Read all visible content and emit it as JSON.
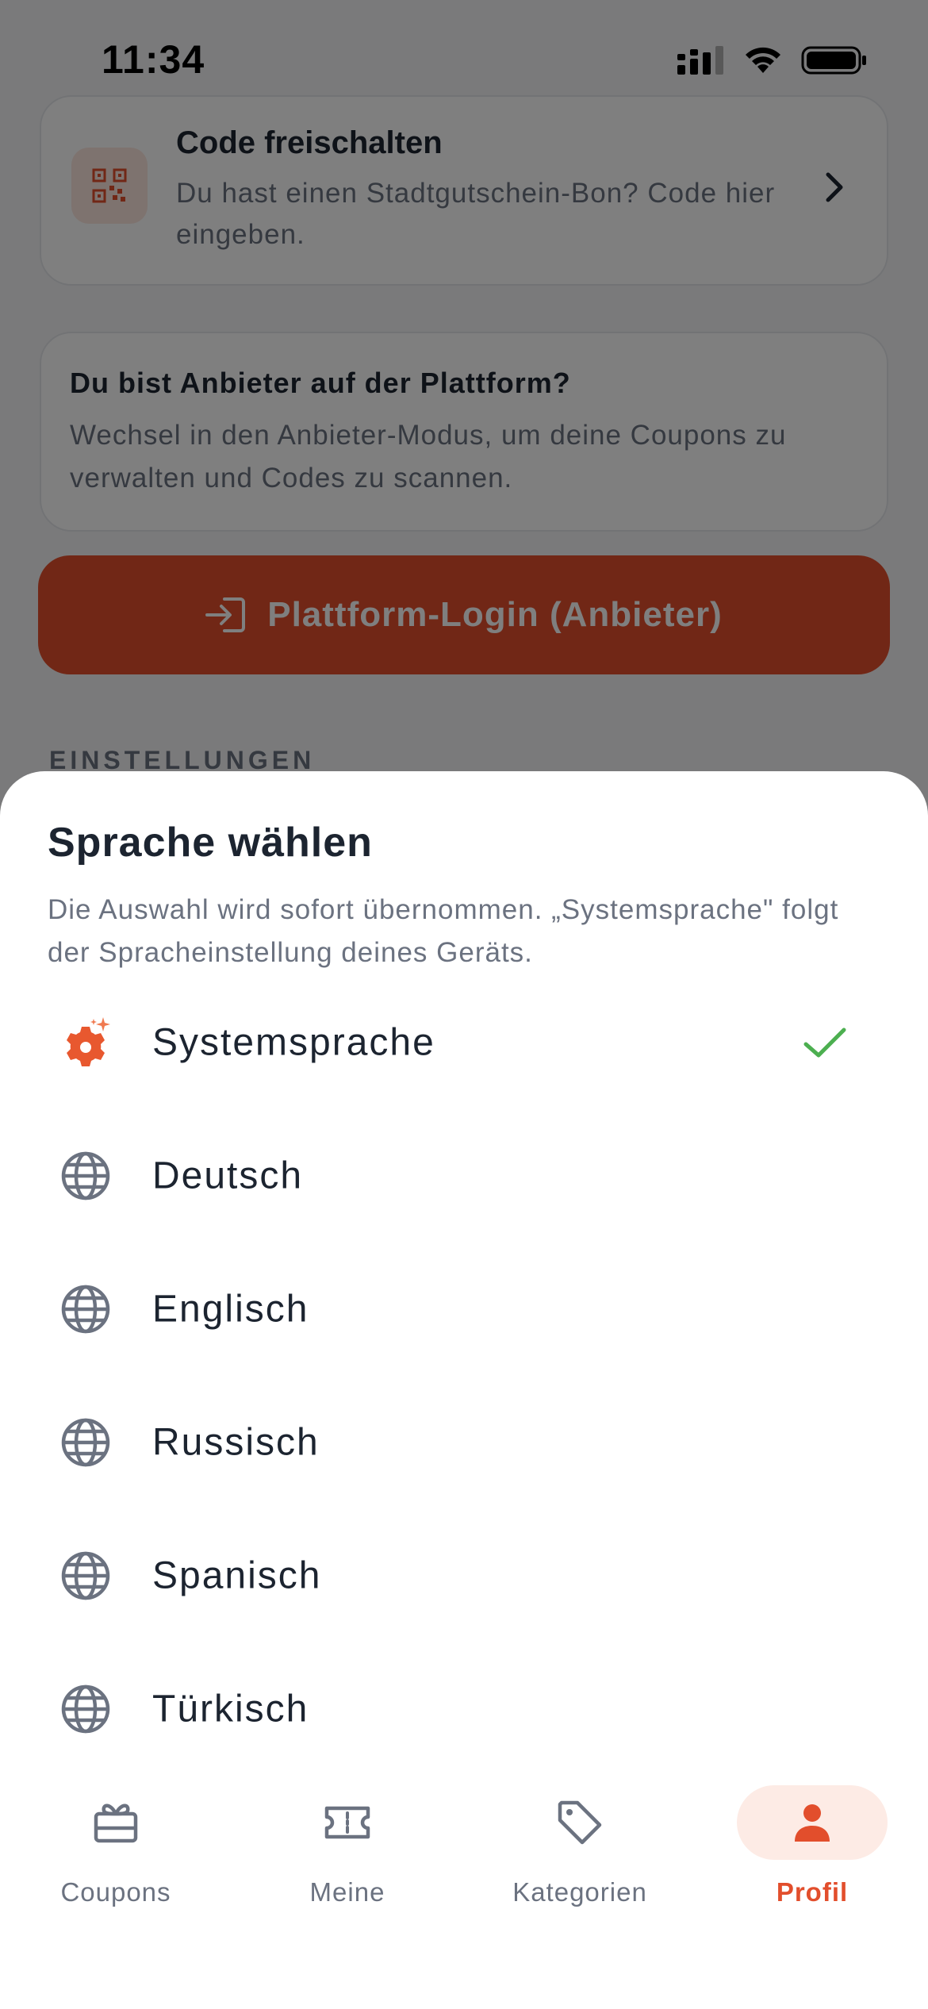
{
  "status": {
    "time": "11:34"
  },
  "code_card": {
    "title": "Code freischalten",
    "subtitle": "Du hast einen Stadtgutschein-Bon? Code hier eingeben."
  },
  "provider_card": {
    "title": "Du bist Anbieter auf der Plattform?",
    "subtitle": "Wechsel in den Anbieter-Modus, um deine Coupons zu verwalten und Codes zu scannen."
  },
  "login_button": {
    "label": "Plattform-Login (Anbieter)"
  },
  "settings_section": {
    "label": "EINSTELLUNGEN"
  },
  "sheet": {
    "title": "Sprache wählen",
    "subtitle": "Die Auswahl wird sofort übernommen. „Systemsprache\" folgt der Spracheinstellung deines Geräts.",
    "options": [
      {
        "label": "Systemsprache",
        "icon": "gear-sparkle-icon",
        "selected": true
      },
      {
        "label": "Deutsch",
        "icon": "globe-icon",
        "selected": false
      },
      {
        "label": "Englisch",
        "icon": "globe-icon",
        "selected": false
      },
      {
        "label": "Russisch",
        "icon": "globe-icon",
        "selected": false
      },
      {
        "label": "Spanisch",
        "icon": "globe-icon",
        "selected": false
      },
      {
        "label": "Türkisch",
        "icon": "globe-icon",
        "selected": false
      }
    ]
  },
  "tabs": [
    {
      "label": "Coupons",
      "icon": "gift-icon",
      "active": false
    },
    {
      "label": "Meine",
      "icon": "ticket-icon",
      "active": false
    },
    {
      "label": "Kategorien",
      "icon": "tag-icon",
      "active": false
    },
    {
      "label": "Profil",
      "icon": "person-icon",
      "active": true
    }
  ],
  "colors": {
    "accent": "#e24e2c",
    "accent_soft": "#fdebe5",
    "check": "#4caf50",
    "icon_gray": "#6b7280",
    "text": "#1c2430"
  }
}
